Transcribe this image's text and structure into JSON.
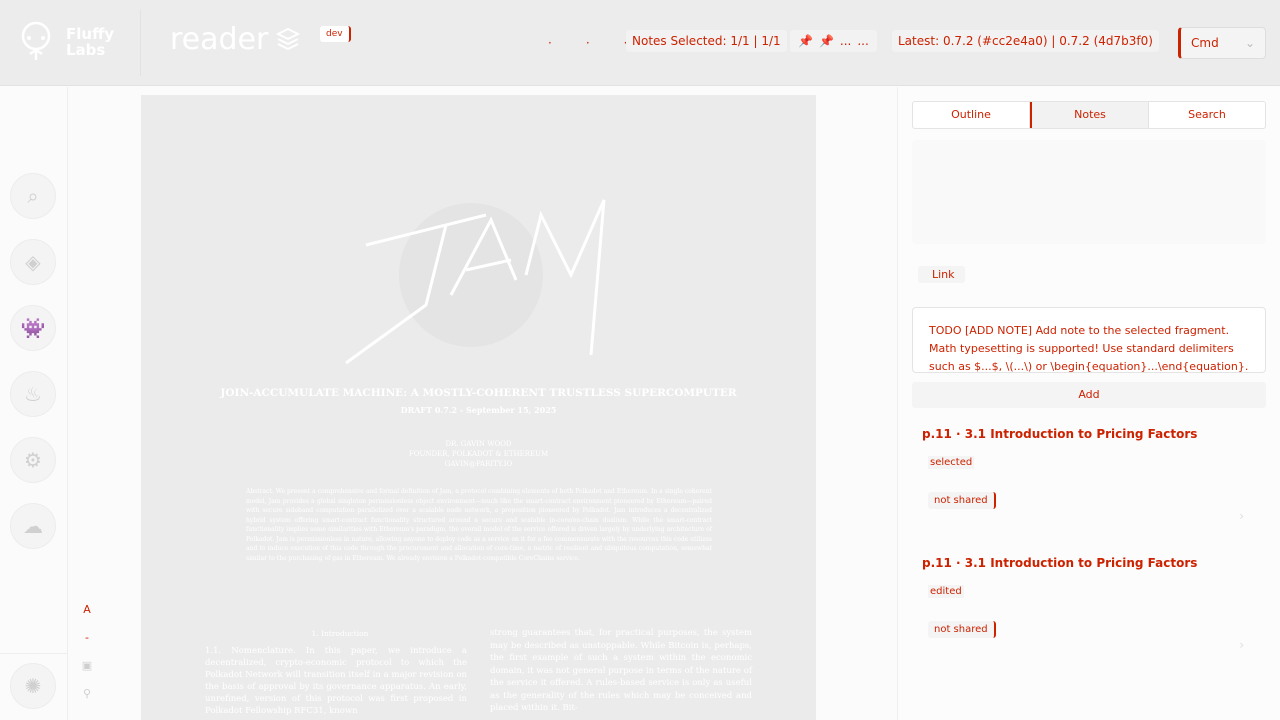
{
  "header": {
    "brand": "Fluffy Labs",
    "brand_line1": "Fluffy",
    "brand_line2": "Labs",
    "app_name": "reader",
    "env_badge": "dev",
    "nav_dots": [
      "·",
      "·",
      "·"
    ],
    "notes_label": "Notes Selected: 1/1 | 1/1",
    "pins": [
      "📌",
      "📌",
      "...",
      "..."
    ],
    "latest_label": "Latest: 0.7.2 (#cc2e4a0) | 0.7.2 (4d7b3f0)",
    "version_select": "Cmd"
  },
  "sidebar": {
    "icons": [
      "search-icon",
      "layers-icon",
      "space-invader-icon",
      "fire-icon",
      "code-icon",
      "cloud-icon",
      "settings-icon"
    ]
  },
  "pdf_tools": [
    "A",
    "-",
    "▣",
    "⚲"
  ],
  "document": {
    "title": "JOIN-ACCUMULATE MACHINE: A MOSTLY-COHERENT TRUSTLESS SUPERCOMPUTER",
    "draft": "DRAFT 0.7.2 - September 15, 2025",
    "author_name": "DR. GAVIN WOOD",
    "author_role": "FOUNDER, POLKADOT & ETHEREUM",
    "author_email": "GAVIN@PARITY.IO",
    "abstract": "Abstract. We present a comprehensive and formal definition of Jam, a protocol combining elements of both Polkadot and Ethereum. In a single coherent model, Jam provides a global singleton permissionless object environment—much like the smart-contract environment pioneered by Ethereum—paired with secure sideband computation parallelized over a scalable node network, a proposition pioneered by Polkadot. Jam introduces a decentralized hybrid system offering smart-contract functionality structured around a secure and scalable in-core/on-chain dualism. While the smart-contract functionality implies some similarities with Ethereum's paradigm, the overall model of the service offered is driven largely by underlying architecture of Polkadot. Jam is permissionless in nature, allowing anyone to deploy code as a service on it for a fee commensurate with the resources this code utilizes and to induce execution of this code through the procurement and allocation of core-time, a metric of resilient and ubiquitous computation, somewhat similar to the purchasing of gas in Ethereum. We already envision a Polkadot-compatible CoreChains service.",
    "section": "1. Introduction",
    "col_left": "1.1. Nomenclature. In this paper, we introduce a decentralized, crypto-economic protocol to which the Polkadot Network will transition itself in a major revision on the basis of approval by its governance apparatus. An early, unrefined, version of this protocol was first proposed in Polkadot Fellowship RFC31, known",
    "col_right": "strong guarantees that, for practical purposes, the system may be described as unstoppable. While Bitcoin is, perhaps, the first example of such a system within the economic domain, it was not general purpose in terms of the nature of the service it offered. A rules-based service is only as useful as the generality of the rules which may be conceived and placed within it. Bit-"
  },
  "panel": {
    "tabs": [
      "Outline",
      "Notes",
      "Search"
    ],
    "link_label": "Link",
    "note_placeholder": "TODO [ADD NOTE] Add note to the selected fragment. Math typesetting is supported! Use standard delimiters such as $...$, \\(...\\) or \\begin{equation}...\\end{equation}.",
    "add_label": "Add",
    "notes": [
      {
        "title": "p.11 · 3.1 Introduction to Pricing Factors",
        "meta": "selected",
        "tag": "not shared"
      },
      {
        "title": "p.11 · 3.1 Introduction to Pricing Factors",
        "meta": "edited",
        "tag": "not shared"
      }
    ]
  },
  "colors": {
    "accent": "#cc2200",
    "header_bg": "#ececec",
    "page_bg": "#ebebeb"
  }
}
